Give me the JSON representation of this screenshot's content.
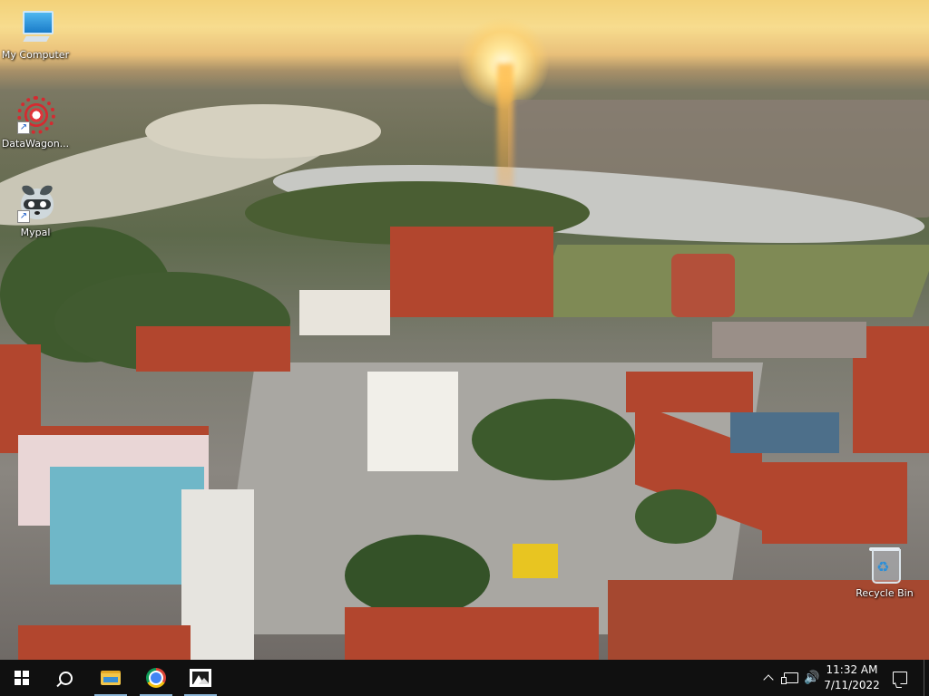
{
  "desktop": {
    "wallpaper": "aerial-town-square-sunset",
    "icons": [
      {
        "label": "My Computer",
        "icon": "computer-icon"
      },
      {
        "label": "DataWagon...",
        "icon": "datawagon-icon"
      },
      {
        "label": "Mypal",
        "icon": "mypal-raccoon-icon"
      },
      {
        "label": "Recycle Bin",
        "icon": "recycle-bin-icon"
      }
    ]
  },
  "taskbar": {
    "background": "#101010",
    "pinned": [
      {
        "name": "start",
        "icon": "windows-icon"
      },
      {
        "name": "search",
        "icon": "search-icon"
      },
      {
        "name": "file-explorer",
        "icon": "folder-icon"
      },
      {
        "name": "chrome",
        "icon": "chrome-icon"
      },
      {
        "name": "photos",
        "icon": "photos-icon"
      }
    ],
    "tray": {
      "chevron": "^",
      "volume_glyph": "🔊",
      "time": "11:32 AM",
      "date": "7/11/2022"
    }
  }
}
